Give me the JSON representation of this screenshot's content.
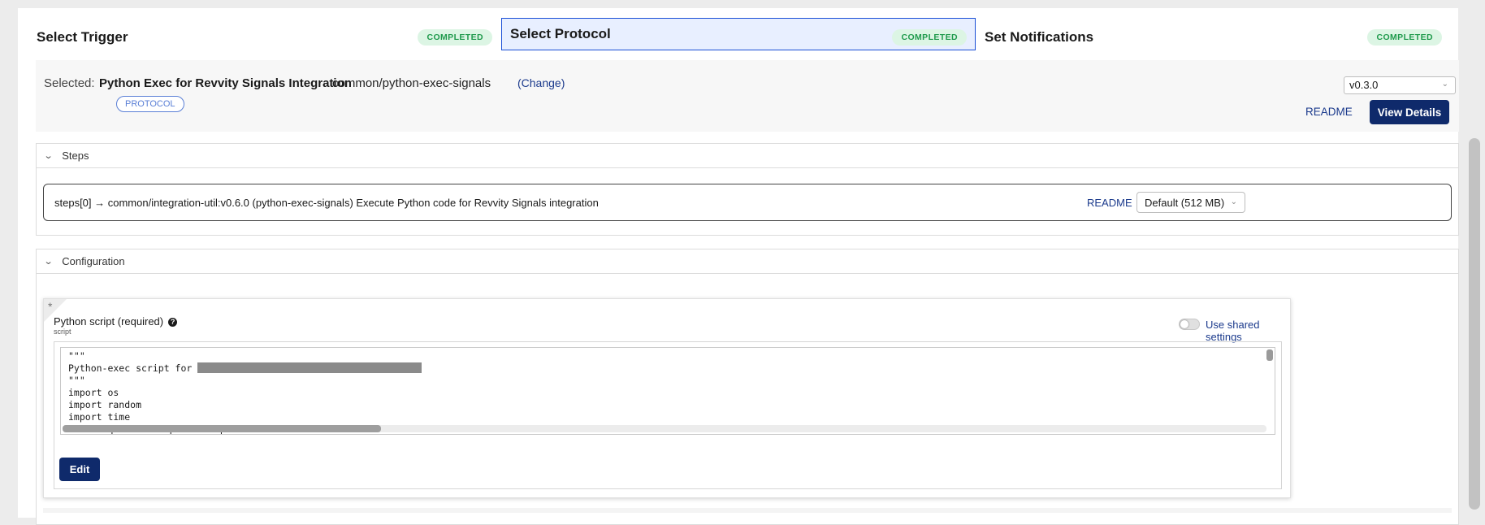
{
  "stepper": {
    "steps": [
      {
        "title": "Select Trigger",
        "status": "COMPLETED"
      },
      {
        "title": "Select Protocol",
        "status": "COMPLETED"
      },
      {
        "title": "Set Notifications",
        "status": "COMPLETED"
      }
    ],
    "active_index": 1
  },
  "selected": {
    "label": "Selected:",
    "name": "Python Exec for Revvity Signals Integration",
    "path": "common/python-exec-signals",
    "change_link": "(Change)",
    "chip": "PROTOCOL",
    "version": "v0.3.0",
    "readme": "README",
    "view_details": "View Details"
  },
  "steps_section": {
    "title": "Steps",
    "row": {
      "text": "steps[0] → common/integration-util:v0.6.0 (python-exec-signals) Execute Python code for Revvity Signals integration",
      "readme": "README",
      "memory": "Default (512 MB)"
    }
  },
  "configuration": {
    "title": "Configuration",
    "field": {
      "required_mark": "*",
      "label": "Python script (required)",
      "help": "?",
      "key": "script",
      "shared_toggle_label": "Use shared settings",
      "shared_toggle_on": false,
      "code_lines": [
        "\"\"\"",
        "Python-exec script for ",
        "\"\"\"",
        "import os",
        "import random",
        "import time",
        "from requests.exceptions import HTTPError"
      ],
      "edit_button": "Edit"
    }
  },
  "colors": {
    "accent": "#0f2a6b",
    "link": "#1b3a8c",
    "badge_bg": "#dcf5e4",
    "badge_text": "#1f9a4c",
    "active_step_bg": "#e8efff",
    "active_step_border": "#1a4fd6"
  },
  "icons": {
    "section_toggle": "chevron-down-icon",
    "select_arrow": "chevron-down-icon",
    "help": "help-circle-icon"
  }
}
